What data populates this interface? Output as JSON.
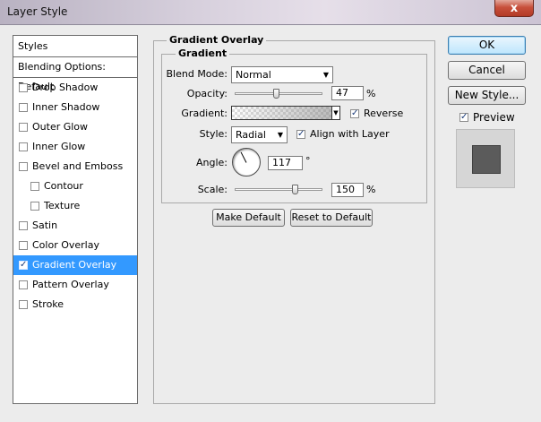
{
  "window": {
    "title": "Layer Style",
    "close_glyph": "x"
  },
  "styles_panel": {
    "header": "Styles",
    "blending": "Blending Options: Default",
    "items": [
      {
        "label": "Drop Shadow",
        "checked": false,
        "indent": false,
        "selected": false
      },
      {
        "label": "Inner Shadow",
        "checked": false,
        "indent": false,
        "selected": false
      },
      {
        "label": "Outer Glow",
        "checked": false,
        "indent": false,
        "selected": false
      },
      {
        "label": "Inner Glow",
        "checked": false,
        "indent": false,
        "selected": false
      },
      {
        "label": "Bevel and Emboss",
        "checked": false,
        "indent": false,
        "selected": false
      },
      {
        "label": "Contour",
        "checked": false,
        "indent": true,
        "selected": false
      },
      {
        "label": "Texture",
        "checked": false,
        "indent": true,
        "selected": false
      },
      {
        "label": "Satin",
        "checked": false,
        "indent": false,
        "selected": false
      },
      {
        "label": "Color Overlay",
        "checked": false,
        "indent": false,
        "selected": false
      },
      {
        "label": "Gradient Overlay",
        "checked": true,
        "indent": false,
        "selected": true
      },
      {
        "label": "Pattern Overlay",
        "checked": false,
        "indent": false,
        "selected": false
      },
      {
        "label": "Stroke",
        "checked": false,
        "indent": false,
        "selected": false
      }
    ]
  },
  "gradient_overlay": {
    "group_title": "Gradient Overlay",
    "subgroup_title": "Gradient",
    "blend_mode_label": "Blend Mode:",
    "blend_mode_value": "Normal",
    "opacity_label": "Opacity:",
    "opacity_value": "47",
    "opacity_unit": "%",
    "opacity_fraction": 0.47,
    "gradient_label": "Gradient:",
    "reverse_label": "Reverse",
    "reverse_checked": true,
    "style_label": "Style:",
    "style_value": "Radial",
    "align_label": "Align with Layer",
    "align_checked": true,
    "angle_label": "Angle:",
    "angle_value": "117",
    "angle_unit": "°",
    "angle_degrees": 117,
    "scale_label": "Scale:",
    "scale_value": "150",
    "scale_unit": "%",
    "scale_fraction": 0.68,
    "make_default_label": "Make Default",
    "reset_default_label": "Reset to Default"
  },
  "actions": {
    "ok_label": "OK",
    "cancel_label": "Cancel",
    "new_style_label": "New Style...",
    "preview_label": "Preview",
    "preview_checked": true
  },
  "colors": {
    "selection": "#3399ff",
    "preview_fill": "#5b5b5b"
  }
}
